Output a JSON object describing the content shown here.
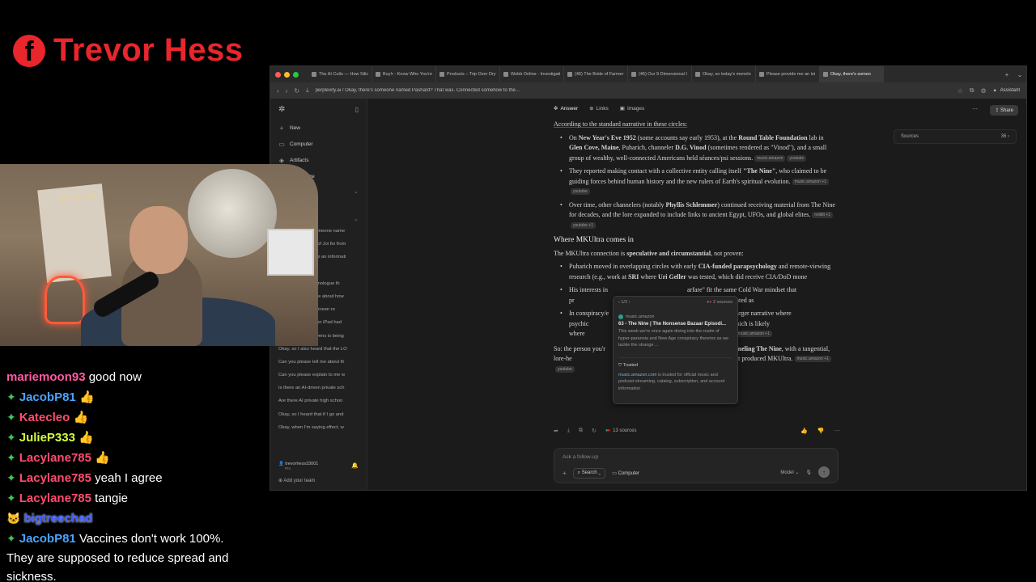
{
  "brand": {
    "icon_letter": "f",
    "name": "Trevor Hess",
    "color": "#e8262b"
  },
  "browser": {
    "tabs": [
      {
        "label": "The AI Cults — How Silic"
      },
      {
        "label": "Buy!r - Know Who You're"
      },
      {
        "label": "Products – Trip Over Dry"
      },
      {
        "label": "Webb Online - Investigati"
      },
      {
        "label": "(46) The Bride of Farmer"
      },
      {
        "label": "(46) Our 9 Dimensional I"
      },
      {
        "label": "Okay, so today's monolo"
      },
      {
        "label": "Please provide me an ini"
      },
      {
        "label": "Okay, there's someo"
      }
    ],
    "new_tab": "+",
    "url": "perplexity.ai  /  Okay, there's someone named Pashard? That was. Connected somehow to the...",
    "assistant_label": "Assistant"
  },
  "sidebar": {
    "nav": [
      {
        "icon": "plus-icon",
        "label": "New"
      },
      {
        "icon": "computer-icon",
        "label": "Computer"
      },
      {
        "icon": "artifacts-icon",
        "label": "Artifacts"
      },
      {
        "icon": "customize-icon",
        "label": "Customize"
      }
    ],
    "spaces_label": "rks",
    "history": [
      "omeone name",
      "t of Joi Ito from",
      "ne an informati",
      "",
      "y's monologue th",
      "e article about how",
      ", so how do I add screen re",
      "The ninth-generation iPad had",
      "Okay, Candace Owens is being",
      "Okay, so I also heard that the LO",
      "Can you please tell me about th",
      "Can you please explain to me w",
      "Is there an AI-driven private sch",
      "Are there AI private high schoo",
      "Okay, so I heard that if I go and",
      "Okay, when I'm saying effect, w"
    ],
    "user": {
      "name": "trevorhess33001",
      "plan": "Pro"
    },
    "add_team": "Add your team"
  },
  "main": {
    "tabs": [
      {
        "icon": "answer-icon",
        "label": "Answer"
      },
      {
        "icon": "links-icon",
        "label": "Links"
      },
      {
        "icon": "images-icon",
        "label": "Images"
      }
    ],
    "share": "Share",
    "sources_panel": {
      "label": "Sources",
      "count": "36"
    },
    "intro": "According to the standard narrative in these circles:",
    "bullets1": [
      {
        "html": "On <b>New Year's Eve 1952</b> (some accounts say early 1953), at the <b>Round Table Foundation</b> lab in <b>Glen Cove, Maine</b>, Puharich, channeler <b>D.G. Vinod</b> (sometimes rendered as \"Vinod\"), and a small group of wealthy, well-connected Americans held séances/psi sessions.",
        "chips": [
          "music.amazon",
          "youtube"
        ]
      },
      {
        "html": "They reported making contact with a collective entity calling itself <b>\"The Nine\"</b>, who claimed to be guiding forces behind human history and the new rulers of Earth's spiritual evolution.",
        "chips": [
          "music.amazon +1",
          "youtube"
        ]
      },
      {
        "html": "Over time, other channelers (notably <b>Phyllis Schlemmer</b>) continued receiving material from The Nine for decades, and the lore expanded to include links to ancient Egypt, UFOs, and global elites.",
        "chips": [
          "reddit +1",
          "youtube +1"
        ]
      }
    ],
    "heading2": "Where MKUltra comes in",
    "intro2": "The MKUltra connection is <b>speculative and circumstantial</b>, not proven:",
    "bullets2": [
      {
        "html": "Puharich moved in overlapping circles with early <b>CIA-funded parapsychology</b> and remote-viewing research (e.g., work at <b>SRI</b> where <b>Uri Geller</b> was tested, which did receive CIA/DoD mone",
        "chips": []
      },
      {
        "html": "His interests in &nbsp;&nbsp;&nbsp;&nbsp;&nbsp;&nbsp;&nbsp;&nbsp;&nbsp;&nbsp;&nbsp;&nbsp;&nbsp;&nbsp;&nbsp;&nbsp;&nbsp;&nbsp;&nbsp;&nbsp;&nbsp;&nbsp;&nbsp;&nbsp;&nbsp;&nbsp;&nbsp;&nbsp;&nbsp;&nbsp;&nbsp;&nbsp;&nbsp;&nbsp;&nbsp;&nbsp;&nbsp;&nbsp;&nbsp;&nbsp;&nbsp;&nbsp;&nbsp;&nbsp;&nbsp;&nbsp;&nbsp;&nbsp;arfare\" fit the same Cold War mindset that pr&nbsp;&nbsp;&nbsp;&nbsp;&nbsp;&nbsp;&nbsp;&nbsp;&nbsp;&nbsp;&nbsp;&nbsp;&nbsp;&nbsp;&nbsp;&nbsp;&nbsp;&nbsp;&nbsp;&nbsp;&nbsp;&nbsp;&nbsp;&nbsp;&nbsp;&nbsp;&nbsp;&nbsp;&nbsp;&nbsp;&nbsp;&nbsp;&nbsp;&nbsp;&nbsp;&nbsp;&nbsp;&nbsp;&nbsp;&nbsp;&nbsp;&nbsp;&nbsp;&nbsp;&nbsp;&nbsp;&nbsp;&nbsp;&nbsp;Puharich himself is not documented as",
        "chips": []
      },
      {
        "html": "In conspiracy/e&nbsp;&nbsp;&nbsp;&nbsp;&nbsp;&nbsp;&nbsp;&nbsp;&nbsp;&nbsp;&nbsp;&nbsp;&nbsp;&nbsp;&nbsp;&nbsp;&nbsp;&nbsp;&nbsp;&nbsp;&nbsp;&nbsp;&nbsp;&nbsp;&nbsp;&nbsp;&nbsp;&nbsp;&nbsp;&nbsp;&nbsp;&nbsp;&nbsp;&nbsp;&nbsp;&nbsp;&nbsp;&nbsp;&nbsp;&nbsp;&nbsp;&nbsp;&nbsp;&nbsp;&nbsp;&nbsp;&nbsp;&nbsp;&nbsp;&nbsp;&nbsp;&nbsp;et woven into a larger narrative where psychic&nbsp;&nbsp;&nbsp;&nbsp;&nbsp;&nbsp;&nbsp;&nbsp;&nbsp;&nbsp;&nbsp;&nbsp;&nbsp;&nbsp;&nbsp;&nbsp;&nbsp;&nbsp;&nbsp;&nbsp;&nbsp;&nbsp;&nbsp;&nbsp;&nbsp;&nbsp;&nbsp;&nbsp;&nbsp;&nbsp;&nbsp;&nbsp;&nbsp;&nbsp;&nbsp;&nbsp;&nbsp;&nbsp;&nbsp;&nbsp;&nbsp;&nbsp;&nbsp;&nbsp;&nbsp;&nbsp;&nbsp;ling all blend together — which is likely where&nbsp;&nbsp;&nbsp;&nbsp;&nbsp;&nbsp;&nbsp;&nbsp;&nbsp;&nbsp;&nbsp;&nbsp;&nbsp;&nbsp;&nbsp;&nbsp;&nbsp;&nbsp;&nbsp;&nbsp;&nbsp;&nbsp;&nbsp;&nbsp;&nbsp;&nbsp;&nbsp;&nbsp;&nbsp;&nbsp;&nbsp;&nbsp;&nbsp;&nbsp;&nbsp;&nbsp;&nbsp;&nbsp;&nbsp;&nbsp;&nbsp;&nbsp;&nbsp;&nbsp;&nbsp;&nbsp;&nbsp;&nbsp;&nbsp;&nbsp;&nbsp;&nbsp;&nbsp;&nbsp;ne\" cluster comes from.",
        "chips": [
          "music.amazon +1"
        ]
      }
    ],
    "conclusion": "So: the person you'r&nbsp;&nbsp;&nbsp;&nbsp;&nbsp;&nbsp;&nbsp;&nbsp;&nbsp;&nbsp;&nbsp;&nbsp;&nbsp;&nbsp;&nbsp;&nbsp;&nbsp;&nbsp;&nbsp;&nbsp;&nbsp;&nbsp;&nbsp;&nbsp;&nbsp;&nbsp;&nbsp;&nbsp;&nbsp;&nbsp;&nbsp;&nbsp;&nbsp;&nbsp;&nbsp;&nbsp;&nbsp;&nbsp;&nbsp;&nbsp;&nbsp;&nbsp;&nbsp;&nbsp;&nbsp;&nbsp;&nbsp;&nbsp;&nbsp;&nbsp;&nbsp;&nbsp;&nbsp;&nbsp;&nbsp;&nbsp;&nbsp;&nbsp;&nbsp;&nbsp;&nbsp;&nbsp;&nbsp;&nbsp;&nbsp;n for <b>channeling The Nine</b>, with a tangential, lore-he&nbsp;&nbsp;&nbsp;&nbsp;&nbsp;&nbsp;&nbsp;&nbsp;&nbsp;&nbsp;&nbsp;&nbsp;&nbsp;&nbsp;&nbsp;&nbsp;&nbsp;&nbsp;&nbsp;&nbsp;&nbsp;&nbsp;&nbsp;&nbsp;&nbsp;&nbsp;&nbsp;&nbsp;&nbsp;&nbsp;&nbsp;&nbsp;&nbsp;&nbsp;&nbsp;&nbsp;&nbsp;&nbsp;&nbsp;&nbsp;&nbsp;&nbsp;&nbsp;&nbsp;&nbsp;&nbsp;&nbsp;&nbsp;&nbsp;&nbsp;&nbsp;&nbsp;&nbsp;&nbsp;&nbsp;&nbsp;&nbsp;&nbsp;&nbsp;&nbsp;&nbsp;&nbsp;&nbsp;ic/intelligence milieu that produced MKUltra.",
    "conclusion_chips": [
      "music.amazon +1",
      "youtube"
    ],
    "sources_count": "13 sources",
    "followup_placeholder": "Ask a follow-up",
    "search_label": "Search",
    "computer_label": "Computer",
    "model_label": "Model"
  },
  "popover": {
    "pager": "1/2",
    "sources": "2 sources",
    "site": "music.amazon",
    "title": "63 - The Nine | The Nonsense Bazaar Episodi...",
    "desc": "This week we're once again diving into the realm of hyper-paranoia and New Age conspiracy theories as we tackle the strange ...",
    "trusted_label": "Trusted",
    "trusted_domain": "music.amazon.com",
    "trusted_desc": " is trusted for official music and podcast streaming, catalog, subscription, and account information"
  },
  "chat": [
    {
      "user": "mariemoon93",
      "color": "#ff5aa5",
      "text": "good now",
      "gem": false
    },
    {
      "user": "JacobP81",
      "color": "#4aa3ff",
      "text": "👍",
      "gem": true
    },
    {
      "user": "Katecleo",
      "color": "#ff4d6d",
      "text": "👍",
      "gem": true
    },
    {
      "user": "JulieP333",
      "color": "#d4ff3a",
      "text": "👍",
      "gem": true
    },
    {
      "user": "Lacylane785",
      "color": "#ff4d6d",
      "text": "👍",
      "gem": true
    },
    {
      "user": "Lacylane785",
      "color": "#ff4d6d",
      "text": "yeah I agree",
      "gem": true
    },
    {
      "user": "Lacylane785",
      "color": "#ff4d6d",
      "text": "tangie",
      "gem": true
    },
    {
      "user": "bigtreechad",
      "color": "#3b5bff",
      "text": "",
      "gem": false
    },
    {
      "user": "JacobP81",
      "color": "#4aa3ff",
      "text": "Vaccines don't work 100%.",
      "gem": true
    }
  ],
  "chat_continuation": "They are supposed to reduce spread and sickness."
}
